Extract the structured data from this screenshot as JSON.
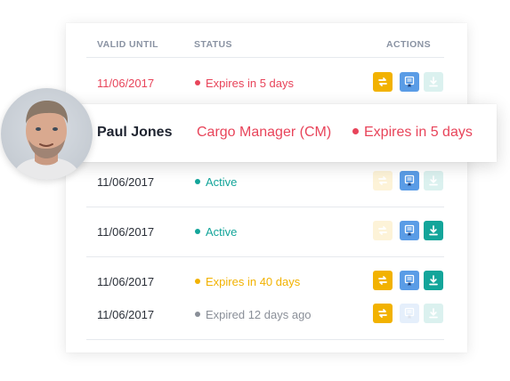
{
  "table": {
    "headers": {
      "valid_until": "VALID UNTIL",
      "status": "STATUS",
      "actions": "ACTIONS"
    },
    "rows": [
      {
        "valid_until": "11/06/2017",
        "status": "Expires in 5 days",
        "status_color": "#e8445a"
      },
      {
        "valid_until": "11/06/2017",
        "status": "Active",
        "status_color": "#13a59a"
      },
      {
        "valid_until": "11/06/2017",
        "status": "Active",
        "status_color": "#13a59a"
      },
      {
        "valid_until": "11/06/2017",
        "status": "Expires in 40 days",
        "status_color": "#f2b200"
      },
      {
        "valid_until": "11/06/2017",
        "status": "Expired 12 days ago",
        "status_color": "#8a8f98"
      }
    ]
  },
  "popup": {
    "name": "Paul Jones",
    "role": "Cargo Manager (CM)",
    "status": "Expires in 5 days"
  },
  "icons": {
    "swap": "swap-arrows-icon",
    "certificate": "certificate-icon",
    "download": "download-icon"
  },
  "colors": {
    "expiring": "#e8445a",
    "active": "#13a59a",
    "warning": "#f2b200",
    "expired": "#8a8f98",
    "certificate": "#5a9ce6"
  }
}
